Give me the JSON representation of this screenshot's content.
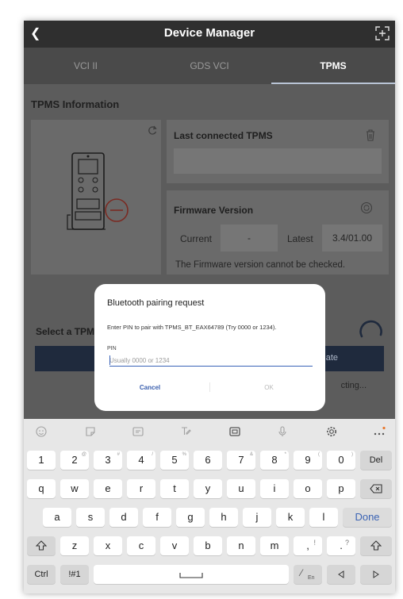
{
  "header": {
    "title": "Device Manager",
    "back_icon": "back-arrow-icon",
    "action_icon": "scan-frame-icon"
  },
  "tabs": [
    {
      "label": "VCI II",
      "active": false
    },
    {
      "label": "GDS VCI",
      "active": false
    },
    {
      "label": "TPMS",
      "active": true
    }
  ],
  "tpms": {
    "section_title": "TPMS Information",
    "last_connected_label": "Last connected TPMS",
    "firmware_label": "Firmware Version",
    "current_label": "Current",
    "current_value": "-",
    "latest_label": "Latest",
    "latest_value": "3.4/01.00",
    "firmware_note": "The Firmware version cannot be checked."
  },
  "select": {
    "label": "Select a TPM",
    "state_text": "ate",
    "status_text": "cting..."
  },
  "dialog": {
    "title": "Bluetooth pairing request",
    "message": "Enter PIN to pair with TPMS_BT_EAX64789 (Try 0000 or 1234).",
    "pin_label": "PIN",
    "pin_value": "",
    "pin_placeholder": "Usually 0000 or 1234",
    "cancel_label": "Cancel",
    "ok_label": "OK"
  },
  "keyboard": {
    "toolbar_icons": [
      "emoji-icon",
      "sticker-icon",
      "gif-icon",
      "handwriting-icon",
      "clipboard-icon",
      "mic-icon",
      "settings-icon",
      "more-icon"
    ],
    "row1": [
      {
        "key": "1",
        "sub": ""
      },
      {
        "key": "2",
        "sub": "@"
      },
      {
        "key": "3",
        "sub": "#"
      },
      {
        "key": "4",
        "sub": "/"
      },
      {
        "key": "5",
        "sub": "%"
      },
      {
        "key": "6",
        "sub": ""
      },
      {
        "key": "7",
        "sub": "&"
      },
      {
        "key": "8",
        "sub": "*"
      },
      {
        "key": "9",
        "sub": "("
      },
      {
        "key": "0",
        "sub": ")"
      }
    ],
    "del_label": "Del",
    "row2": [
      "q",
      "w",
      "e",
      "r",
      "t",
      "y",
      "u",
      "i",
      "o",
      "p"
    ],
    "row3": [
      "a",
      "s",
      "d",
      "f",
      "g",
      "h",
      "j",
      "k",
      "l"
    ],
    "done_label": "Done",
    "row4": [
      "z",
      "x",
      "c",
      "v",
      "b",
      "n",
      "m"
    ],
    "comma_key": ",",
    "comma_sub": "!",
    "period_key": ".",
    "period_sub": "?",
    "ctrl_label": "Ctrl",
    "symbols_label": "!#1",
    "lang_label": "En",
    "accent_color": "#3c64b4"
  }
}
